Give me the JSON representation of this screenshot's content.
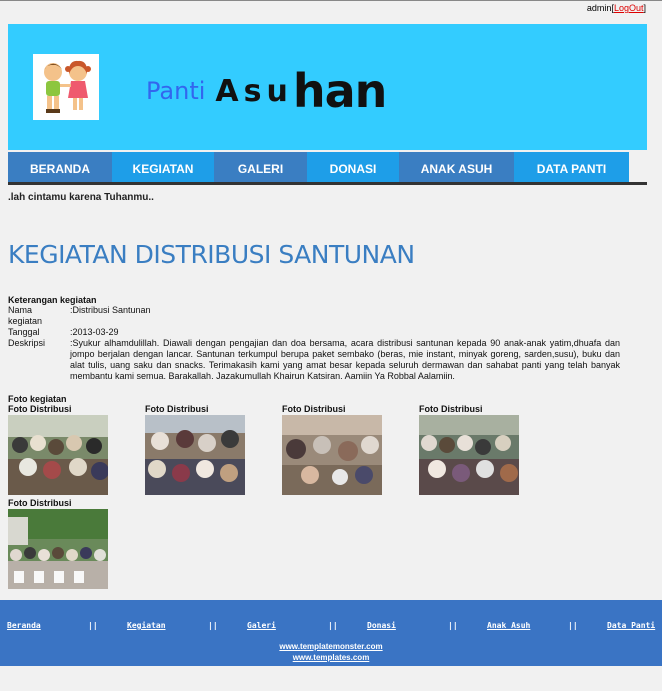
{
  "auth": {
    "user": "admin",
    "logout": "LogOut"
  },
  "header": {
    "panti": "Panti",
    "asu": "Asu",
    "han": "han"
  },
  "nav": [
    {
      "label": "BERANDA",
      "color": "#3a7ec2"
    },
    {
      "label": "KEGIATAN",
      "color": "#1e9ee8"
    },
    {
      "label": "GALERI",
      "color": "#3a7ec2"
    },
    {
      "label": "DONASI",
      "color": "#1e9ee8"
    },
    {
      "label": "ANAK ASUH",
      "color": "#3a7ec2"
    },
    {
      "label": "DATA PANTI",
      "color": "#1e9ee8"
    }
  ],
  "tagline": ".lah cintamu karena Tuhanmu..",
  "page_title": "KEGIATAN DISTRIBUSI SANTUNAN",
  "detail": {
    "heading": "Keterangan kegiatan",
    "rows": [
      {
        "key": "Nama kegiatan",
        "value": ":Distribusi Santunan"
      },
      {
        "key": "Tanggal",
        "value": ":2013-03-29"
      },
      {
        "key": "Deskripsi",
        "value": ":Syukur alhamdulillah. Diawali dengan pengajian dan doa bersama, acara distribusi santunan kepada 90 anak-anak yatim,dhuafa dan jompo berjalan dengan lancar. Santunan terkumpul berupa paket sembako (beras, mie instant, minyak goreng, sarden,susu), buku dan alat tulis, uang saku dan snacks. Terimakasih kami yang amat besar kepada seluruh dermawan dan sahabat panti yang telah banyak membantu kami semua. Barakallah. Jazakumullah Khairun Katsiran. Aamiin Ya Robbal Aalamiin."
      }
    ]
  },
  "photos": {
    "heading": "Foto kegiatan",
    "items": [
      {
        "label": "Foto Distribusi"
      },
      {
        "label": "Foto Distribusi"
      },
      {
        "label": "Foto Distribusi"
      },
      {
        "label": "Foto Distribusi"
      },
      {
        "label": "Foto Distribusi"
      }
    ]
  },
  "footer": {
    "links": [
      "Beranda",
      "Kegiatan",
      "Galeri",
      "Donasi",
      "Anak Asuh",
      "Data Panti"
    ],
    "separator": "||",
    "urls": [
      "www.templatemonster.com",
      "www.templates.com"
    ]
  }
}
